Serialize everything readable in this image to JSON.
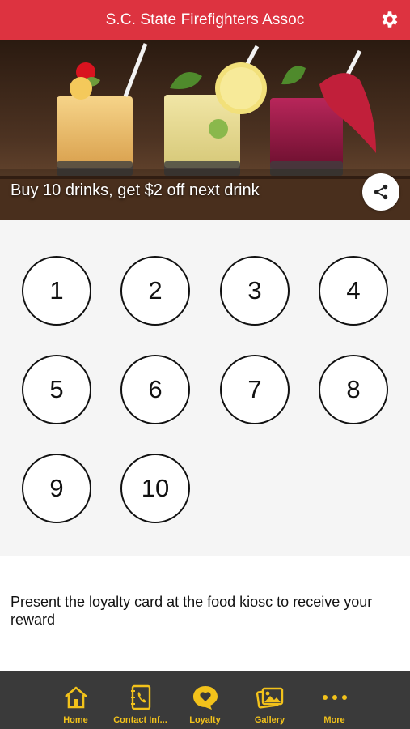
{
  "header": {
    "title": "S.C. State Firefighters Assoc",
    "settings_icon": "gear-icon"
  },
  "hero": {
    "caption": "Buy 10 drinks, get $2 off next drink",
    "share_icon": "share-icon"
  },
  "stamps": [
    "1",
    "2",
    "3",
    "4",
    "5",
    "6",
    "7",
    "8",
    "9",
    "10"
  ],
  "note": "Present the loyalty card at the food kiosc to receive your reward",
  "tabs": [
    {
      "label": "Home",
      "icon": "home-icon"
    },
    {
      "label": "Contact Inf...",
      "icon": "contact-book-icon"
    },
    {
      "label": "Loyalty",
      "icon": "heart-bubble-icon"
    },
    {
      "label": "Gallery",
      "icon": "gallery-icon"
    },
    {
      "label": "More",
      "icon": "more-icon"
    }
  ],
  "colors": {
    "header": "#dd3340",
    "tabbar": "#3a3a3a",
    "accent": "#f2c21b"
  }
}
